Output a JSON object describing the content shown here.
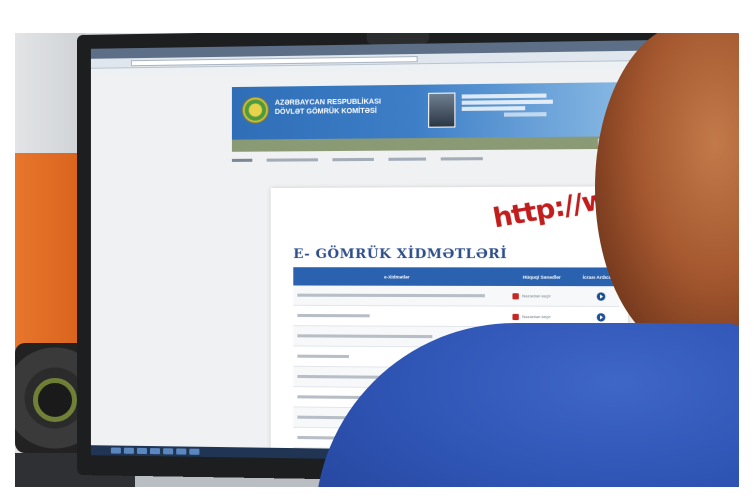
{
  "header": {
    "agency_line1": "AZƏRBAYCAN RESPUBLİKASI",
    "agency_line2": "DÖVLƏT GÖMRÜK KOMİTƏSİ"
  },
  "page": {
    "title": "E- GÖMRÜK XİDMƏTLƏRİ",
    "http_art": "http://ww"
  },
  "table": {
    "col_service": "e-Xidmətlər",
    "col_docs": "Hüquqi Sənədlər",
    "col_steps": "İcrası Ardıcıllığı",
    "docs_label": "Nəzərdən keçir"
  },
  "colors": {
    "header_blue": "#2f6eb7",
    "table_header": "#2a62b0",
    "title_blue": "#2f4f8a",
    "http_red": "#c21d1d",
    "shirt_blue": "#2f55b5",
    "hair": "#a5582f",
    "chair_orange": "#e8762c"
  }
}
